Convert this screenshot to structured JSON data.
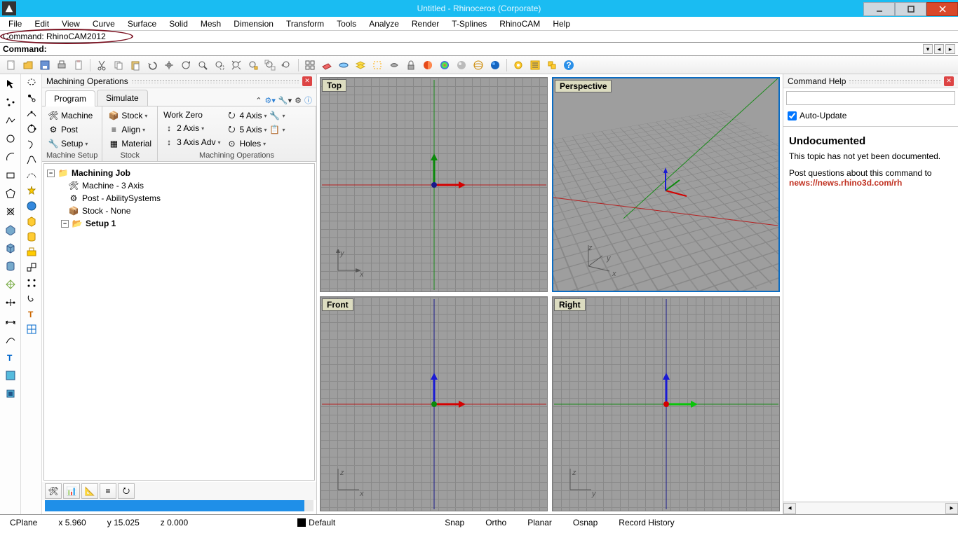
{
  "title": "Untitled - Rhinoceros (Corporate)",
  "menus": [
    "File",
    "Edit",
    "View",
    "Curve",
    "Surface",
    "Solid",
    "Mesh",
    "Dimension",
    "Transform",
    "Tools",
    "Analyze",
    "Render",
    "T-Splines",
    "RhinoCAM",
    "Help"
  ],
  "command_line1": "Command: RhinoCAM2012",
  "command_line2_label": "Command:",
  "machining_panel": {
    "title": "Machining Operations",
    "tabs": [
      "Program",
      "Simulate"
    ],
    "groups": {
      "machine_setup": {
        "label": "Machine Setup",
        "items": [
          "Machine",
          "Post",
          "Setup"
        ]
      },
      "stock": {
        "label": "Stock",
        "items": [
          "Stock",
          "Align",
          "Material"
        ]
      },
      "machining_ops": {
        "label": "Machining Operations",
        "items_left": [
          "Work Zero",
          "2 Axis",
          "3 Axis Adv"
        ],
        "items_right": [
          "4 Axis",
          "5 Axis",
          "Holes"
        ]
      }
    },
    "tree": {
      "root": "Machining Job",
      "children": [
        "Machine - 3 Axis",
        "Post - AbilitySystems",
        "Stock - None",
        "Setup 1"
      ]
    }
  },
  "viewports": [
    "Top",
    "Perspective",
    "Front",
    "Right"
  ],
  "help_panel": {
    "title": "Command Help",
    "auto_update": "Auto-Update",
    "heading": "Undocumented",
    "text1": "This topic has not yet been documented.",
    "text2": "Post questions about this command to",
    "link": "news://news.rhino3d.com/rh"
  },
  "status": {
    "cplane": "CPlane",
    "x": "x 5.960",
    "y": "y 15.025",
    "z": "z 0.000",
    "layer": "Default",
    "toggles": [
      "Snap",
      "Ortho",
      "Planar",
      "Osnap",
      "Record History"
    ]
  }
}
